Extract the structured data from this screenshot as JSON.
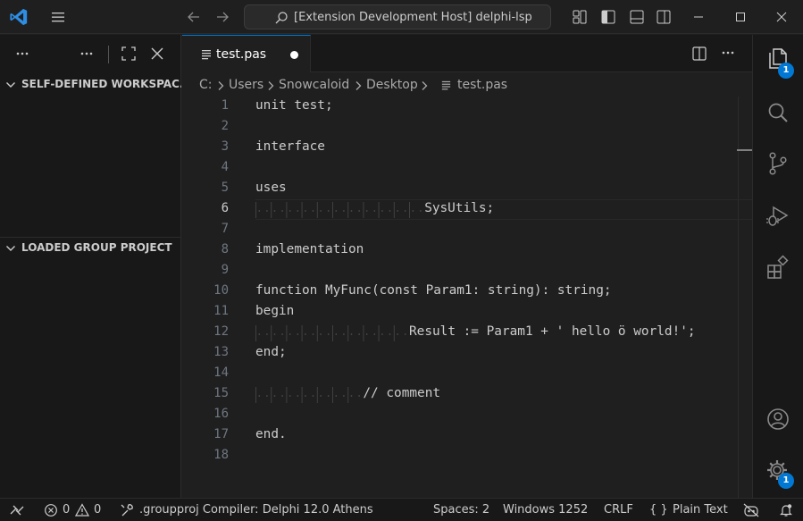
{
  "titlebar": {
    "search_text": "[Extension Development Host] delphi-lsp"
  },
  "sidebar": {
    "sections": [
      {
        "label": "SELF-DEFINED WORKSPAC..."
      },
      {
        "label": "LOADED GROUP PROJECT"
      }
    ]
  },
  "tab": {
    "label": "test.pas",
    "dirty": true
  },
  "breadcrumb": {
    "items": [
      "C:",
      "Users",
      "Snowcaloid",
      "Desktop",
      "test.pas"
    ]
  },
  "editor": {
    "active_line": 6,
    "lines": [
      {
        "n": "1",
        "text": "unit test;"
      },
      {
        "n": "2",
        "text": ""
      },
      {
        "n": "3",
        "text": "interface"
      },
      {
        "n": "4",
        "text": ""
      },
      {
        "n": "5",
        "text": "uses"
      },
      {
        "n": "6",
        "text": "SysUtils;"
      },
      {
        "n": "7",
        "text": ""
      },
      {
        "n": "8",
        "text": "implementation"
      },
      {
        "n": "9",
        "text": ""
      },
      {
        "n": "10",
        "text": "function MyFunc(const Param1: string): string;"
      },
      {
        "n": "11",
        "text": "begin"
      },
      {
        "n": "12",
        "text": "Result := Param1 + ' hello ö world!';"
      },
      {
        "n": "13",
        "text": "end;"
      },
      {
        "n": "14",
        "text": ""
      },
      {
        "n": "15",
        "text": "// comment"
      },
      {
        "n": "16",
        "text": ""
      },
      {
        "n": "17",
        "text": "end."
      },
      {
        "n": "18",
        "text": ""
      }
    ]
  },
  "activitybar": {
    "explorer_badge": "1",
    "settings_badge": "1"
  },
  "statusbar": {
    "errors": "0",
    "warnings": "0",
    "project": ".groupproj Compiler: Delphi 12.0 Athens",
    "spaces": "Spaces: 2",
    "encoding": "Windows 1252",
    "eol": "CRLF",
    "language": "Plain Text",
    "language_icon_text": "{ }"
  },
  "colors": {
    "accent": "#0078d4",
    "background": "#1f1f1f",
    "sidebar": "#181818",
    "text": "#cccccc"
  }
}
